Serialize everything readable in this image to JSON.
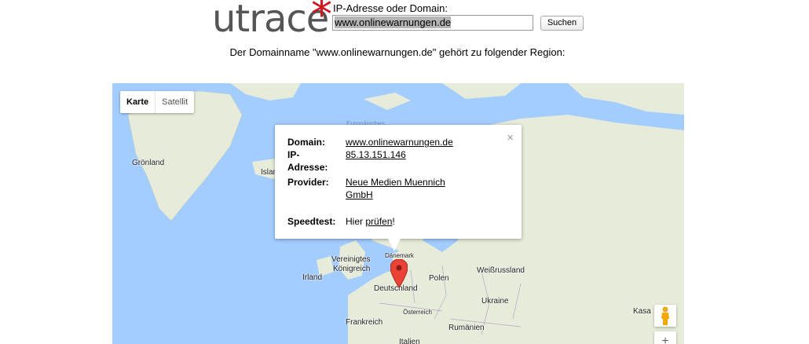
{
  "header": {
    "logo_text": "utrace",
    "logo_star": "*",
    "ip_label": "IP-Adresse oder Domain:",
    "search_value": "www.onlinewarnungen.de",
    "search_button": "Suchen",
    "region_text": "Der Domainname \"www.onlinewarnungen.de\" gehört zu folgender Region:"
  },
  "map": {
    "type_buttons": [
      "Karte",
      "Satellit"
    ],
    "labels": {
      "groenland": "Grönland",
      "island": "Islan",
      "europaeisches": "Europäisches",
      "vereinigtes1": "Vereinigtes",
      "vereinigtes2": "Königreich",
      "irland": "Irland",
      "daenemark": "Dänemark",
      "deutschland": "Deutschland",
      "polen": "Polen",
      "weissrussland": "Weißrussland",
      "ukraine": "Ukraine",
      "frankreich": "Frankreich",
      "oesterreich": "Österreich",
      "rumaenien": "Rumänien",
      "italien": "Italien",
      "kasachstan": "Kasa"
    },
    "colors": {
      "water": "#a3ccff",
      "land": "#e6ecd9",
      "pin": "#e94335"
    },
    "icons": {
      "pin": "map-pin-icon",
      "pegman": "pegman-icon"
    }
  },
  "info": {
    "domain_label": "Domain:",
    "domain_value": "www.onlinewarnungen.de",
    "ip_label_1": "IP-",
    "ip_label_2": "Adresse:",
    "ip_value": "85.13.151.146",
    "provider_label": "Provider:",
    "provider_value_1": "Neue Medien Muennich",
    "provider_value_2": "GmbH",
    "speedtest_label": "Speedtest:",
    "speedtest_prefix": "Hier ",
    "speedtest_link": "prüfen",
    "speedtest_suffix": "!",
    "close_glyph": "×"
  },
  "zoom": {
    "plus": "+"
  }
}
